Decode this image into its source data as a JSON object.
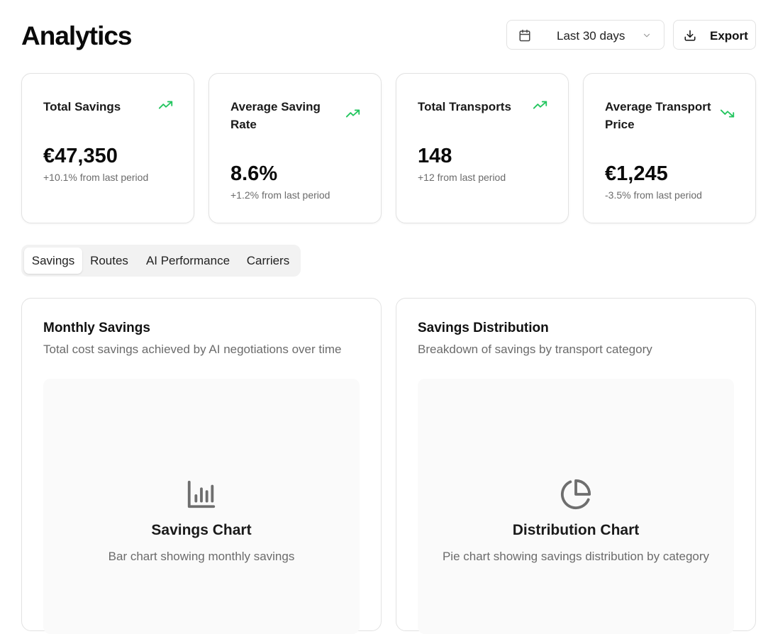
{
  "header": {
    "title": "Analytics",
    "date_range": "Last 30 days",
    "export_label": "Export"
  },
  "stats": [
    {
      "title": "Total Savings",
      "value": "€47,350",
      "delta": "+10.1% from last period",
      "trend": "up"
    },
    {
      "title": "Average Saving Rate",
      "value": "8.6%",
      "delta": "+1.2% from last period",
      "trend": "up"
    },
    {
      "title": "Total Transports",
      "value": "148",
      "delta": "+12 from last period",
      "trend": "up"
    },
    {
      "title": "Average Transport Price",
      "value": "€1,245",
      "delta": "-3.5% from last period",
      "trend": "down"
    }
  ],
  "tabs": [
    {
      "label": "Savings",
      "active": true
    },
    {
      "label": "Routes",
      "active": false
    },
    {
      "label": "AI Performance",
      "active": false
    },
    {
      "label": "Carriers",
      "active": false
    }
  ],
  "panels": [
    {
      "title": "Monthly Savings",
      "subtitle": "Total cost savings achieved by AI negotiations over time",
      "placeholder_title": "Savings Chart",
      "placeholder_text": "Bar chart showing monthly savings",
      "icon": "bar-chart-icon"
    },
    {
      "title": "Savings Distribution",
      "subtitle": "Breakdown of savings by transport category",
      "placeholder_title": "Distribution Chart",
      "placeholder_text": "Pie chart showing savings distribution by category",
      "icon": "pie-chart-icon"
    }
  ],
  "colors": {
    "trend_up": "#22c55e",
    "muted_text": "#6b6b6b",
    "border": "#e2e2e2",
    "placeholder_bg": "#fafafa",
    "icon_gray": "#6e6e6e"
  }
}
